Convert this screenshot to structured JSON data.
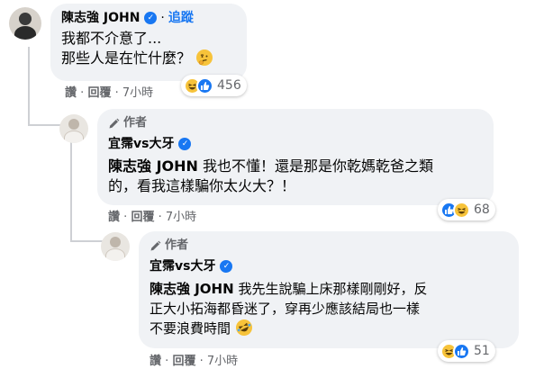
{
  "comments": [
    {
      "author": "陳志強 JOHN",
      "verified": true,
      "follow_label": "追蹤",
      "lines": [
        "我都不介意了...",
        "那些人是在忙什麼？"
      ],
      "trailing_emoji": "thinking-face",
      "reaction_count": "456",
      "reactions": [
        "haha",
        "like"
      ],
      "actions": {
        "like": "讚",
        "reply": "回覆",
        "time": "7小時"
      }
    },
    {
      "author_badge": "作者",
      "author": "宜霈vs大牙",
      "verified": true,
      "tag": "陳志強 JOHN",
      "text_line1": "我也不懂！還是那是你乾媽乾爸之類",
      "text_line2": "的，看我這樣騙你太火大？！",
      "reaction_count": "68",
      "reactions": [
        "like",
        "haha"
      ],
      "actions": {
        "like": "讚",
        "reply": "回覆",
        "time": "7小時"
      }
    },
    {
      "author_badge": "作者",
      "author": "宜霈vs大牙",
      "verified": true,
      "tag": "陳志強 JOHN",
      "text_line1": "我先生說騙上床那樣剛剛好，反",
      "text_line2": "正大小拓海都昏迷了，穿再少應該結局也一樣",
      "text_line3": "不要浪費時間",
      "trailing_emoji": "rofl-face",
      "reaction_count": "51",
      "reactions": [
        "haha",
        "like"
      ],
      "actions": {
        "like": "讚",
        "reply": "回覆",
        "time": "7小時"
      }
    }
  ],
  "separator": "·",
  "colors": {
    "link_blue": "#1877f2",
    "bubble_bg": "#f0f2f5",
    "meta_gray": "#65676b"
  }
}
